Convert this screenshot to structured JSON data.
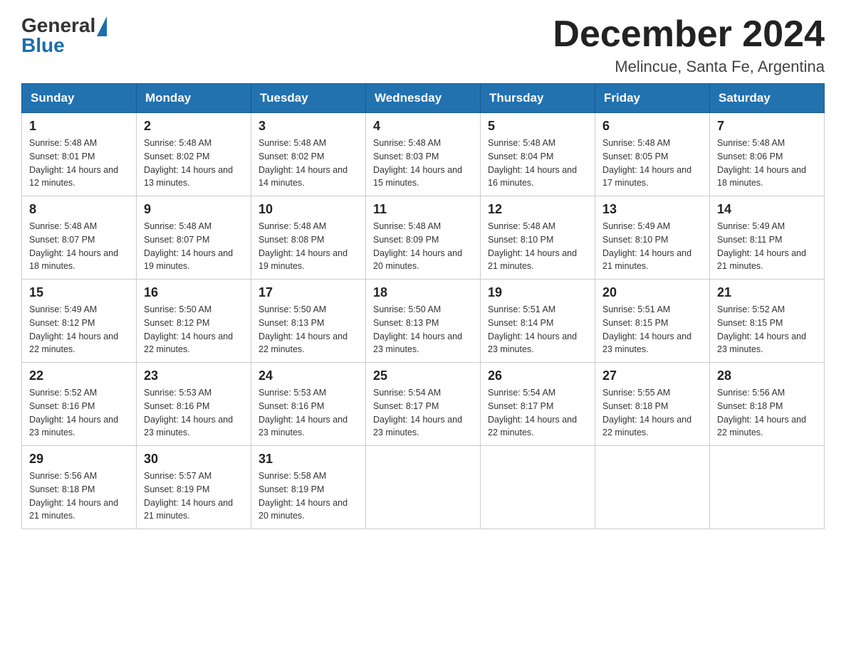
{
  "header": {
    "logo_general": "General",
    "logo_blue": "Blue",
    "month_title": "December 2024",
    "location": "Melincue, Santa Fe, Argentina"
  },
  "days_of_week": [
    "Sunday",
    "Monday",
    "Tuesday",
    "Wednesday",
    "Thursday",
    "Friday",
    "Saturday"
  ],
  "weeks": [
    [
      {
        "day": "1",
        "sunrise": "Sunrise: 5:48 AM",
        "sunset": "Sunset: 8:01 PM",
        "daylight": "Daylight: 14 hours and 12 minutes."
      },
      {
        "day": "2",
        "sunrise": "Sunrise: 5:48 AM",
        "sunset": "Sunset: 8:02 PM",
        "daylight": "Daylight: 14 hours and 13 minutes."
      },
      {
        "day": "3",
        "sunrise": "Sunrise: 5:48 AM",
        "sunset": "Sunset: 8:02 PM",
        "daylight": "Daylight: 14 hours and 14 minutes."
      },
      {
        "day": "4",
        "sunrise": "Sunrise: 5:48 AM",
        "sunset": "Sunset: 8:03 PM",
        "daylight": "Daylight: 14 hours and 15 minutes."
      },
      {
        "day": "5",
        "sunrise": "Sunrise: 5:48 AM",
        "sunset": "Sunset: 8:04 PM",
        "daylight": "Daylight: 14 hours and 16 minutes."
      },
      {
        "day": "6",
        "sunrise": "Sunrise: 5:48 AM",
        "sunset": "Sunset: 8:05 PM",
        "daylight": "Daylight: 14 hours and 17 minutes."
      },
      {
        "day": "7",
        "sunrise": "Sunrise: 5:48 AM",
        "sunset": "Sunset: 8:06 PM",
        "daylight": "Daylight: 14 hours and 18 minutes."
      }
    ],
    [
      {
        "day": "8",
        "sunrise": "Sunrise: 5:48 AM",
        "sunset": "Sunset: 8:07 PM",
        "daylight": "Daylight: 14 hours and 18 minutes."
      },
      {
        "day": "9",
        "sunrise": "Sunrise: 5:48 AM",
        "sunset": "Sunset: 8:07 PM",
        "daylight": "Daylight: 14 hours and 19 minutes."
      },
      {
        "day": "10",
        "sunrise": "Sunrise: 5:48 AM",
        "sunset": "Sunset: 8:08 PM",
        "daylight": "Daylight: 14 hours and 19 minutes."
      },
      {
        "day": "11",
        "sunrise": "Sunrise: 5:48 AM",
        "sunset": "Sunset: 8:09 PM",
        "daylight": "Daylight: 14 hours and 20 minutes."
      },
      {
        "day": "12",
        "sunrise": "Sunrise: 5:48 AM",
        "sunset": "Sunset: 8:10 PM",
        "daylight": "Daylight: 14 hours and 21 minutes."
      },
      {
        "day": "13",
        "sunrise": "Sunrise: 5:49 AM",
        "sunset": "Sunset: 8:10 PM",
        "daylight": "Daylight: 14 hours and 21 minutes."
      },
      {
        "day": "14",
        "sunrise": "Sunrise: 5:49 AM",
        "sunset": "Sunset: 8:11 PM",
        "daylight": "Daylight: 14 hours and 21 minutes."
      }
    ],
    [
      {
        "day": "15",
        "sunrise": "Sunrise: 5:49 AM",
        "sunset": "Sunset: 8:12 PM",
        "daylight": "Daylight: 14 hours and 22 minutes."
      },
      {
        "day": "16",
        "sunrise": "Sunrise: 5:50 AM",
        "sunset": "Sunset: 8:12 PM",
        "daylight": "Daylight: 14 hours and 22 minutes."
      },
      {
        "day": "17",
        "sunrise": "Sunrise: 5:50 AM",
        "sunset": "Sunset: 8:13 PM",
        "daylight": "Daylight: 14 hours and 22 minutes."
      },
      {
        "day": "18",
        "sunrise": "Sunrise: 5:50 AM",
        "sunset": "Sunset: 8:13 PM",
        "daylight": "Daylight: 14 hours and 23 minutes."
      },
      {
        "day": "19",
        "sunrise": "Sunrise: 5:51 AM",
        "sunset": "Sunset: 8:14 PM",
        "daylight": "Daylight: 14 hours and 23 minutes."
      },
      {
        "day": "20",
        "sunrise": "Sunrise: 5:51 AM",
        "sunset": "Sunset: 8:15 PM",
        "daylight": "Daylight: 14 hours and 23 minutes."
      },
      {
        "day": "21",
        "sunrise": "Sunrise: 5:52 AM",
        "sunset": "Sunset: 8:15 PM",
        "daylight": "Daylight: 14 hours and 23 minutes."
      }
    ],
    [
      {
        "day": "22",
        "sunrise": "Sunrise: 5:52 AM",
        "sunset": "Sunset: 8:16 PM",
        "daylight": "Daylight: 14 hours and 23 minutes."
      },
      {
        "day": "23",
        "sunrise": "Sunrise: 5:53 AM",
        "sunset": "Sunset: 8:16 PM",
        "daylight": "Daylight: 14 hours and 23 minutes."
      },
      {
        "day": "24",
        "sunrise": "Sunrise: 5:53 AM",
        "sunset": "Sunset: 8:16 PM",
        "daylight": "Daylight: 14 hours and 23 minutes."
      },
      {
        "day": "25",
        "sunrise": "Sunrise: 5:54 AM",
        "sunset": "Sunset: 8:17 PM",
        "daylight": "Daylight: 14 hours and 23 minutes."
      },
      {
        "day": "26",
        "sunrise": "Sunrise: 5:54 AM",
        "sunset": "Sunset: 8:17 PM",
        "daylight": "Daylight: 14 hours and 22 minutes."
      },
      {
        "day": "27",
        "sunrise": "Sunrise: 5:55 AM",
        "sunset": "Sunset: 8:18 PM",
        "daylight": "Daylight: 14 hours and 22 minutes."
      },
      {
        "day": "28",
        "sunrise": "Sunrise: 5:56 AM",
        "sunset": "Sunset: 8:18 PM",
        "daylight": "Daylight: 14 hours and 22 minutes."
      }
    ],
    [
      {
        "day": "29",
        "sunrise": "Sunrise: 5:56 AM",
        "sunset": "Sunset: 8:18 PM",
        "daylight": "Daylight: 14 hours and 21 minutes."
      },
      {
        "day": "30",
        "sunrise": "Sunrise: 5:57 AM",
        "sunset": "Sunset: 8:19 PM",
        "daylight": "Daylight: 14 hours and 21 minutes."
      },
      {
        "day": "31",
        "sunrise": "Sunrise: 5:58 AM",
        "sunset": "Sunset: 8:19 PM",
        "daylight": "Daylight: 14 hours and 20 minutes."
      },
      null,
      null,
      null,
      null
    ]
  ]
}
